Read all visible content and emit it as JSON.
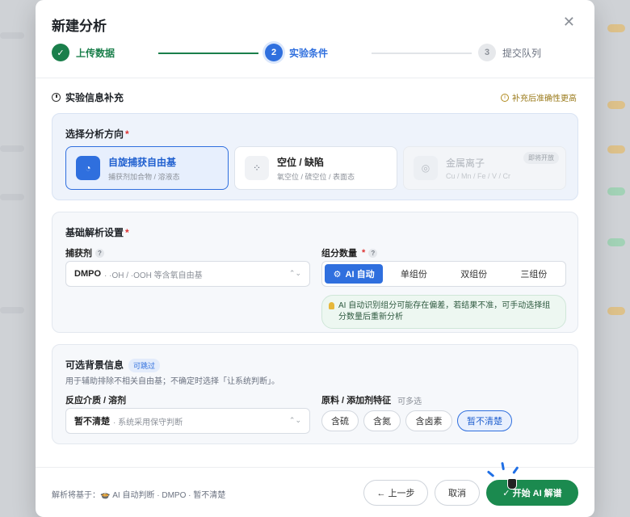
{
  "modal": {
    "title": "新建分析",
    "close_icon": "close-icon"
  },
  "steps": [
    {
      "num": "✓",
      "label": "上传数据",
      "state": "done"
    },
    {
      "num": "2",
      "label": "实验条件",
      "state": "active"
    },
    {
      "num": "3",
      "label": "提交队列",
      "state": "todo"
    }
  ],
  "section": {
    "title": "实验信息补充",
    "note": "补充后准确性更高"
  },
  "direction": {
    "title": "选择分析方向",
    "required": "*",
    "options": [
      {
        "main": "自旋捕获自由基",
        "sub": "捕获剂加合物 / 溶液态",
        "icon": "radical-icon",
        "state": "selected"
      },
      {
        "main": "空位 / 缺陷",
        "sub": "氧空位 / 硫空位 / 表面态",
        "icon": "defect-icon",
        "state": "normal"
      },
      {
        "main": "金属离子",
        "sub": "Cu / Mn / Fe / V / Cr",
        "icon": "metal-icon",
        "state": "disabled",
        "badge": "即将开放"
      }
    ]
  },
  "basic": {
    "title": "基础解析设置",
    "required": "*",
    "trap_label": "捕获剂",
    "trap_value": "DMPO",
    "trap_hint": "· ·OH / ·OOH 等含氧自由基",
    "group_label": "组分数量",
    "group_required": "*",
    "group_options": [
      "AI 自动",
      "单组份",
      "双组份",
      "三组份"
    ],
    "group_selected": 0,
    "ai_tip": "AI 自动识别组分可能存在偏差，若结果不准，可手动选择组分数量后重新分析"
  },
  "optional": {
    "title": "可选背景信息",
    "badge": "可跳过",
    "sub": "用于辅助排除不相关自由基；不确定时选择「让系统判断」。",
    "medium_label": "反应介质 / 溶剂",
    "medium_value": "暂不清楚",
    "medium_hint": "· 系统采用保守判断",
    "additive_label": "原料 / 添加剂特征",
    "additive_multi": "可多选",
    "chips": [
      "含硫",
      "含氮",
      "含卤素",
      "暂不清楚"
    ],
    "chip_selected": 3
  },
  "footer": {
    "note": "解析将基于：🍲 AI 自动判断 · DMPO · 暂不清楚",
    "prev": "← 上一步",
    "cancel": "取消",
    "start": "✓ 开始 AI 解谱"
  },
  "colors": {
    "primary": "#2f6fde",
    "success": "#1b8a4f",
    "warn": "#9a7a1a"
  }
}
